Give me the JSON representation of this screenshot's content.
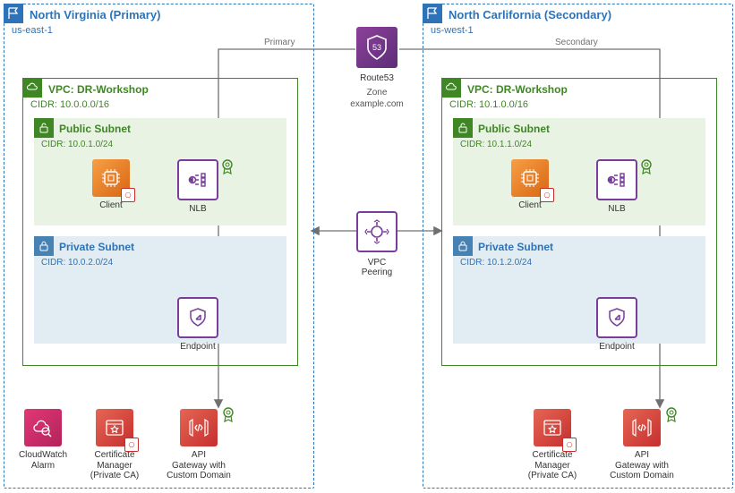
{
  "regions": {
    "primary": {
      "title": "North Virginia (Primary)",
      "code": "us-east-1"
    },
    "secondary": {
      "title": "North Carlifornia (Secondary)",
      "code": "us-west-1"
    }
  },
  "vpc": {
    "primary": {
      "title": "VPC: DR-Workshop",
      "cidr": "CIDR: 10.0.0.0/16"
    },
    "secondary": {
      "title": "VPC: DR-Workshop",
      "cidr": "CIDR: 10.1.0.0/16"
    }
  },
  "subnets": {
    "primary": {
      "public": {
        "title": "Public Subnet",
        "cidr": "CIDR: 10.0.1.0/24"
      },
      "private": {
        "title": "Private Subnet",
        "cidr": "CIDR: 10.0.2.0/24"
      }
    },
    "secondary": {
      "public": {
        "title": "Public Subnet",
        "cidr": "CIDR: 10.1.1.0/24"
      },
      "private": {
        "title": "Private Subnet",
        "cidr": "CIDR: 10.1.2.0/24"
      }
    }
  },
  "labels": {
    "client": "Client",
    "nlb": "NLB",
    "endpoint": "Endpoint",
    "cw": "CloudWatch\nAlarm",
    "acm": "Certificate\nManager\n(Private CA)",
    "api": "API\nGateway with\nCustom Domain",
    "route53": "Route53",
    "zone": "Zone\nexample.com",
    "peering": "VPC\nPeering",
    "edge_primary": "Primary",
    "edge_secondary": "Secondary"
  }
}
